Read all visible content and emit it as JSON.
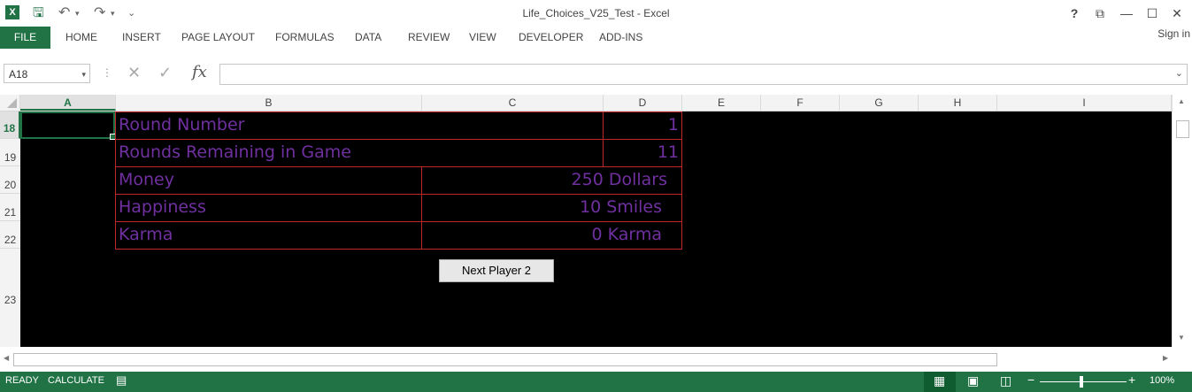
{
  "window": {
    "title": "Life_Choices_V25_Test - Excel",
    "help": "?",
    "ribbon_display": "⧉",
    "minimize": "—",
    "restore": "☐",
    "close": "✕"
  },
  "quick_access": {
    "app_icon": "X",
    "save": "🖫",
    "undo": "↶",
    "undo_dd": "▾",
    "redo": "↷",
    "redo_dd": "▾",
    "customize": "⌄"
  },
  "ribbon": {
    "file": "FILE",
    "tabs": [
      "HOME",
      "INSERT",
      "PAGE LAYOUT",
      "FORMULAS",
      "DATA",
      "REVIEW",
      "VIEW",
      "DEVELOPER",
      "ADD-INS"
    ],
    "signin": "Sign in"
  },
  "formula_bar": {
    "name_box": "A18",
    "name_dd": "▾",
    "sep": "⋮",
    "cancel": "✕",
    "enter": "✓",
    "fx": "fx",
    "formula": "",
    "expand": "⌄"
  },
  "columns": [
    "A",
    "B",
    "C",
    "D",
    "E",
    "F",
    "G",
    "H",
    "I"
  ],
  "rows": [
    "18",
    "19",
    "20",
    "21",
    "22",
    "23"
  ],
  "sheet": {
    "round_label": "Round Number",
    "round_value": "1",
    "remaining_label": "Rounds Remaining in Game",
    "remaining_value": "11",
    "money_label": "Money",
    "money_value": "250 Dollars",
    "happiness_label": "Happiness",
    "happiness_value": "10 Smiles",
    "karma_label": "Karma",
    "karma_value": "0 Karma",
    "button": "Next Player 2"
  },
  "scroll": {
    "up": "▲",
    "down": "▼",
    "left": "◀",
    "right": "▶"
  },
  "status": {
    "ready": "READY",
    "calculate": "CALCULATE",
    "macro_icon": "▤",
    "normal_view": "▦",
    "page_layout_view": "▣",
    "page_break_view": "◫",
    "zoom_out": "−",
    "zoom_in": "+",
    "zoom": "100%"
  },
  "colors": {
    "excel_green": "#217346",
    "cell_text": "#7030a0",
    "cell_border": "#c0272d",
    "sheet_bg": "#000000"
  }
}
